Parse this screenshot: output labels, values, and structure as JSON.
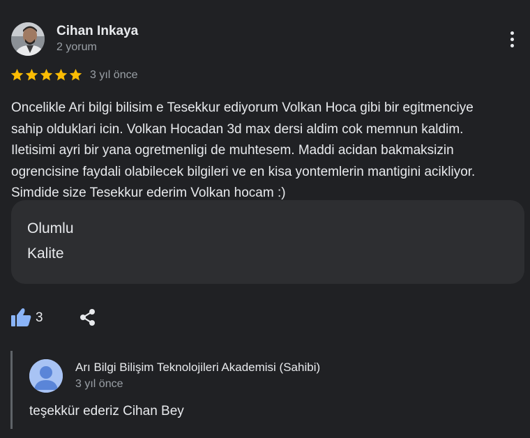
{
  "author": {
    "name": "Cihan Inkaya",
    "meta": "2 yorum"
  },
  "rating": {
    "stars": 5,
    "max": 5,
    "star_color": "#fbbc04"
  },
  "review": {
    "date": "3 yıl önce",
    "lines": [
      "Oncelikle Ari bilgi bilisim e Tesekkur ediyorum Volkan Hoca gibi bir egitmenciye",
      "sahip olduklari icin. Volkan Hocadan 3d max dersi aldim cok memnun kaldim.",
      "Iletisimi ayri bir yana ogretmenligi de muhtesem. Maddi acidan bakmaksizin",
      "ogrencisine faydali olabilecek bilgileri ve en kisa yontemlerin mantigini acikliyor.",
      "Simdide size Tesekkur ederim Volkan hocam :)"
    ]
  },
  "tags": [
    "Olumlu",
    "Kalite"
  ],
  "actions": {
    "like_count": "3",
    "like_icon": "thumbs-up-icon",
    "share_icon": "share-icon",
    "like_color": "#8ab4f8"
  },
  "owner_reply": {
    "name": "Arı Bilgi Bilişim Teknolojileri Akademisi (Sahibi)",
    "date": "3 yıl önce",
    "text": "teşekkür ederiz Cihan Bey"
  }
}
